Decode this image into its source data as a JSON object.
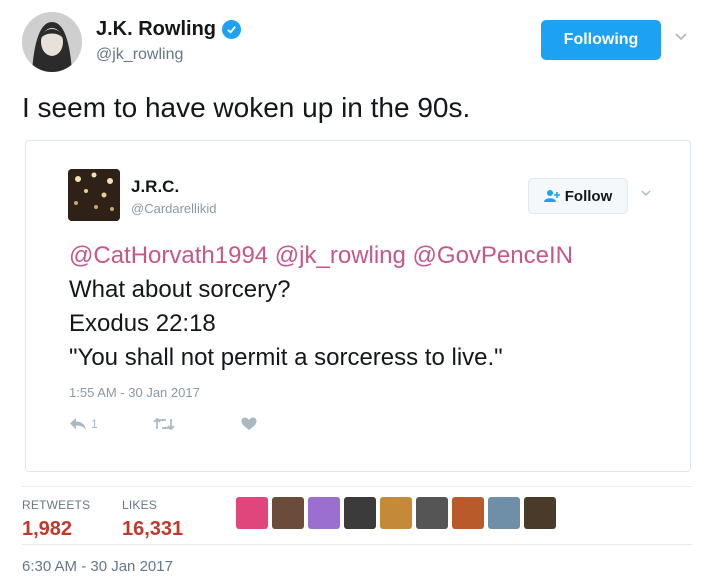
{
  "author": {
    "name": "J.K. Rowling",
    "handle": "@jk_rowling",
    "follow_label": "Following"
  },
  "tweet": {
    "text": "I seem to have woken up in the 90s."
  },
  "quoted": {
    "name": "J.R.C.",
    "handle": "@Cardarellikid",
    "follow_label": "Follow",
    "mentions": "@CatHorvath1994 @jk_rowling @GovPenceIN",
    "line2": "What about sorcery?",
    "line3": "Exodus 22:18",
    "line4": "\"You shall not permit a sorceress to live.\"",
    "timestamp": "1:55 AM - 30 Jan 2017",
    "reply_count": "1"
  },
  "stats": {
    "retweets_label": "RETWEETS",
    "retweets_value": "1,982",
    "likes_label": "LIKES",
    "likes_value": "16,331"
  },
  "liker_colors": [
    "#e0457b",
    "#6b4b3a",
    "#9a6fd0",
    "#3b3b3b",
    "#c48a3a",
    "#555555",
    "#b85a2a",
    "#6f8fa8",
    "#4a3a2a"
  ],
  "footer": {
    "timestamp": "6:30 AM - 30 Jan 2017"
  },
  "icons": [
    "verified-badge-icon",
    "chevron-down-icon",
    "add-user-icon",
    "reply-icon",
    "retweet-icon",
    "like-icon"
  ]
}
